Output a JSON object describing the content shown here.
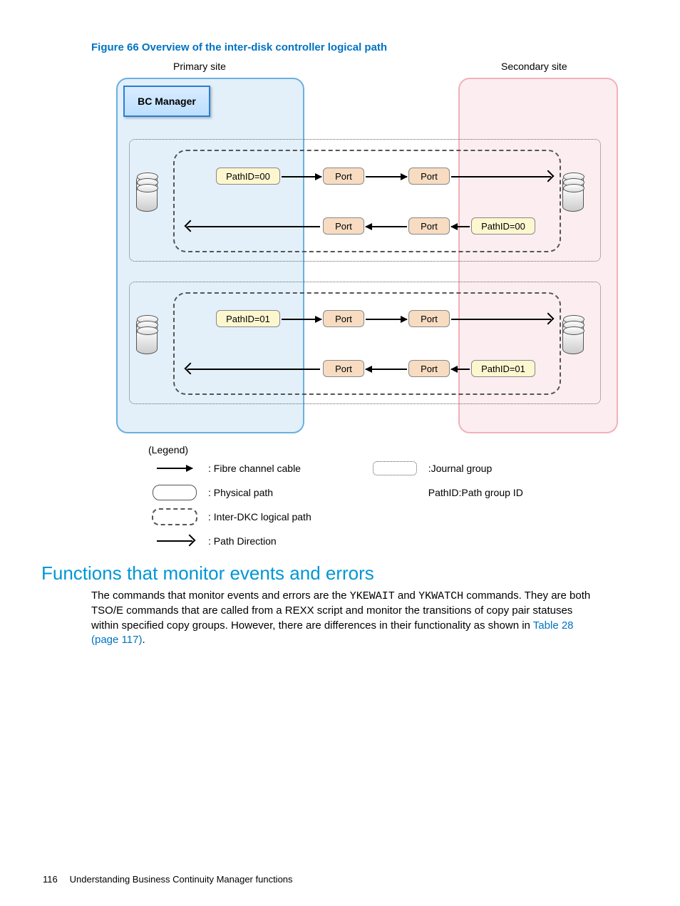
{
  "figure": {
    "caption": "Figure 66 Overview of the inter-disk controller logical path",
    "primary_site": "Primary site",
    "secondary_site": "Secondary site",
    "bc_manager": "BC Manager",
    "labels": {
      "pathid00": "PathID=00",
      "pathid01": "PathID=01",
      "port": "Port"
    }
  },
  "legend": {
    "title": "(Legend)",
    "fibre": ": Fibre channel cable",
    "physical": ": Physical path",
    "inter_dkc": ": Inter-DKC logical path",
    "direction": ": Path Direction",
    "journal": ":Journal group",
    "pathid_desc": "PathID:Path group ID"
  },
  "section_heading": "Functions that monitor events and errors",
  "paragraph": {
    "t1": "The commands that monitor events and errors are the ",
    "cmd1": "YKEWAIT",
    "t2": " and ",
    "cmd2": "YKWATCH",
    "t3": " commands. They are both TSO/E commands that are called from a REXX script and monitor the transitions of copy pair statuses within specified copy groups. However, there are differences in their functionality as shown in ",
    "link": "Table 28 (page 117)",
    "t4": "."
  },
  "footer": {
    "page": "116",
    "chapter": "Understanding Business Continuity Manager functions"
  }
}
